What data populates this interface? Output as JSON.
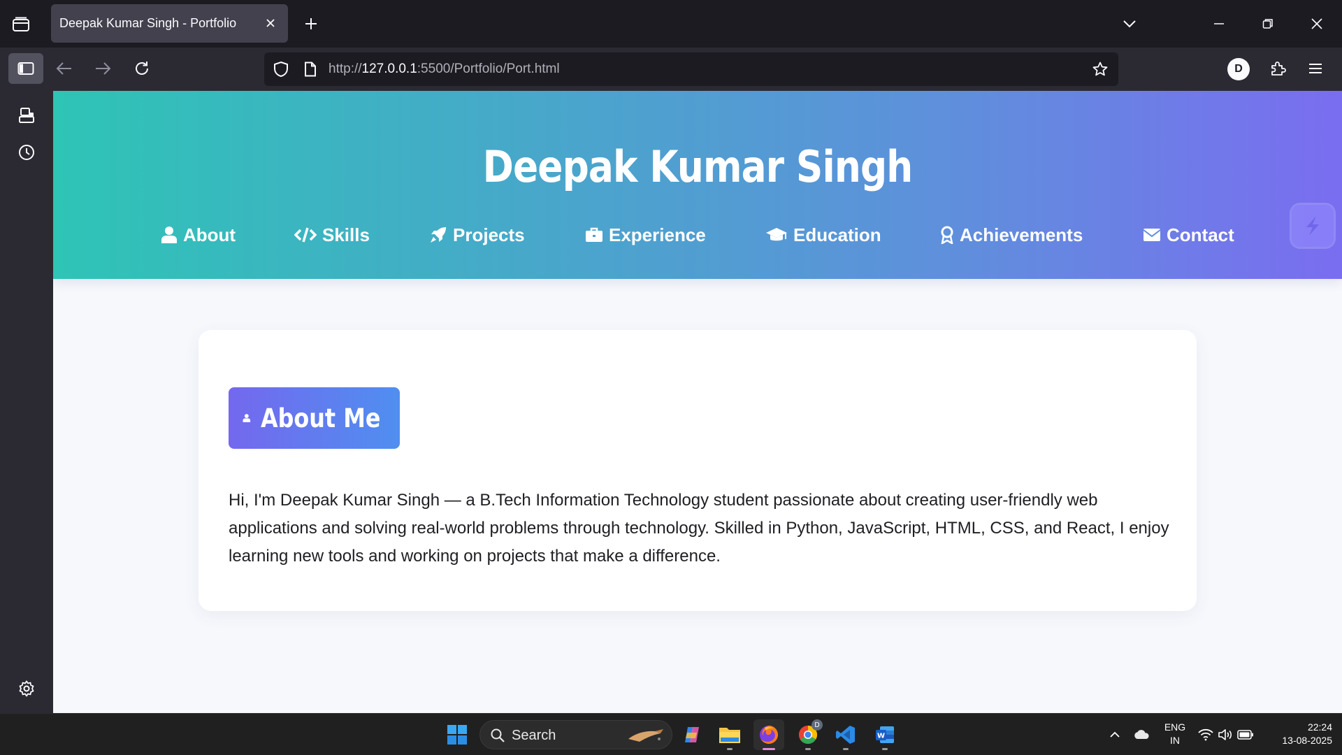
{
  "browser": {
    "tab_title": "Deepak Kumar Singh - Portfolio",
    "url_prefix": "http://",
    "url_host": "127.0.0.1",
    "url_rest": ":5500/Portfolio/Port.html",
    "account_initial": "D"
  },
  "page": {
    "hero_title": "Deepak Kumar Singh",
    "nav": [
      {
        "label": "About",
        "icon": "user-icon"
      },
      {
        "label": "Skills",
        "icon": "code-icon"
      },
      {
        "label": "Projects",
        "icon": "rocket-icon"
      },
      {
        "label": "Experience",
        "icon": "briefcase-icon"
      },
      {
        "label": "Education",
        "icon": "graduation-cap-icon"
      },
      {
        "label": "Achievements",
        "icon": "award-icon"
      },
      {
        "label": "Contact",
        "icon": "envelope-icon"
      }
    ],
    "about": {
      "heading": "About Me",
      "text": "Hi, I'm Deepak Kumar Singh — a B.Tech Information Technology student passionate about creating user-friendly web applications and solving real-world problems through technology. Skilled in Python, JavaScript, HTML, CSS, and React, I enjoy learning new tools and working on projects that make a difference."
    },
    "colors": {
      "hero_gradient_start": "#2ec4b6",
      "hero_gradient_end": "#7a6df0",
      "chip_gradient_start": "#7468ee",
      "chip_gradient_end": "#4f8ff0"
    }
  },
  "taskbar": {
    "search_label": "Search",
    "chrome_badge": "D",
    "lang_line1": "ENG",
    "lang_line2": "IN",
    "time": "22:24",
    "date": "13-08-2025"
  }
}
